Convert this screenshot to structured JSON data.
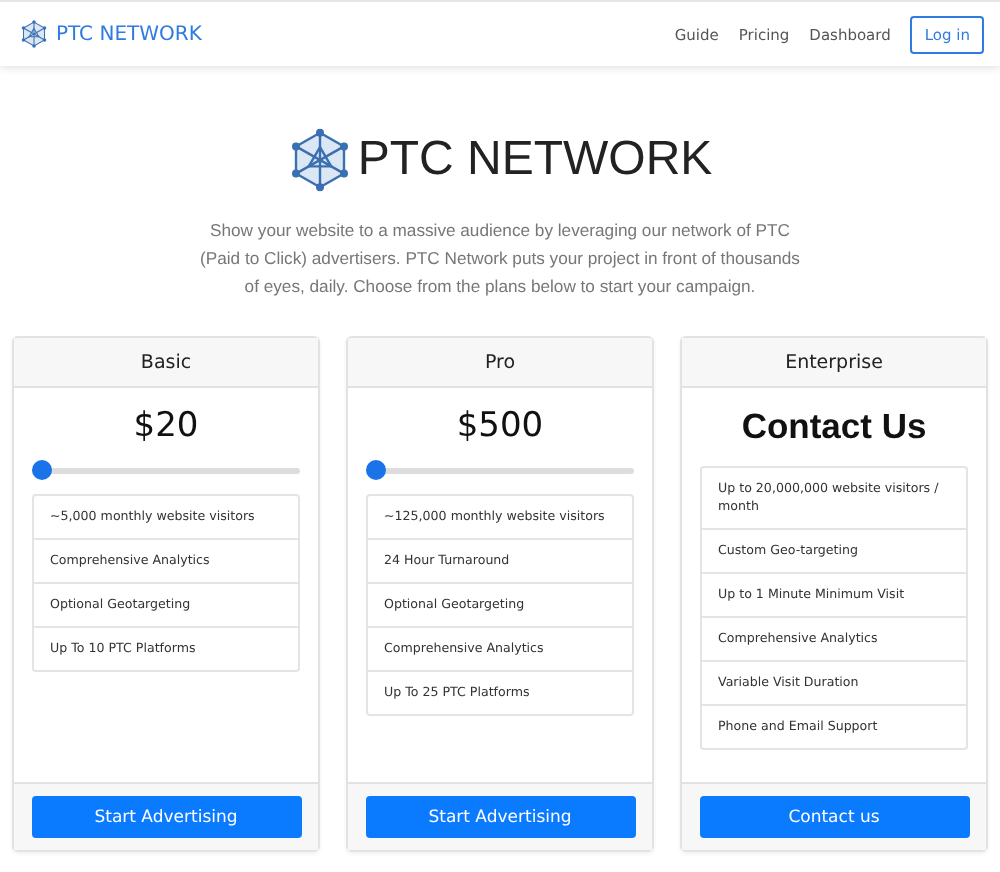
{
  "navbar": {
    "brand": "PTC NETWORK",
    "links": [
      "Guide",
      "Pricing",
      "Dashboard"
    ],
    "login": "Log in"
  },
  "hero": {
    "title": "PTC NETWORK",
    "text": "Show your website to a massive audience by leveraging our network of PTC (Paid to Click) advertisers. PTC Network puts your project in front of thousands of eyes, daily. Choose from the plans below to start your campaign."
  },
  "plans": [
    {
      "name": "Basic",
      "price": "$20",
      "kind": "slider",
      "level": 0,
      "features": [
        "~5,000 monthly website visitors",
        "Comprehensive Analytics",
        "Optional Geotargeting",
        "Up To 10 PTC Platforms"
      ],
      "button": "Start Advertising"
    },
    {
      "name": "Pro",
      "price": "$500",
      "kind": "slider",
      "level": 0,
      "features": [
        "~125,000 monthly website visitors",
        "24 Hour Turnaround",
        "Optional Geotargeting",
        "Comprehensive Analytics",
        "Up To 25 PTC Platforms"
      ],
      "button": "Start Advertising"
    },
    {
      "name": "Enterprise",
      "price": "Contact Us",
      "kind": "contact",
      "features": [
        "Up to 20,000,000 website visitors / month",
        "Custom Geo-targeting",
        "Up to 1 Minute Minimum Visit",
        "Comprehensive Analytics",
        "Variable Visit Duration",
        "Phone and Email Support"
      ],
      "button": "Contact us"
    }
  ]
}
